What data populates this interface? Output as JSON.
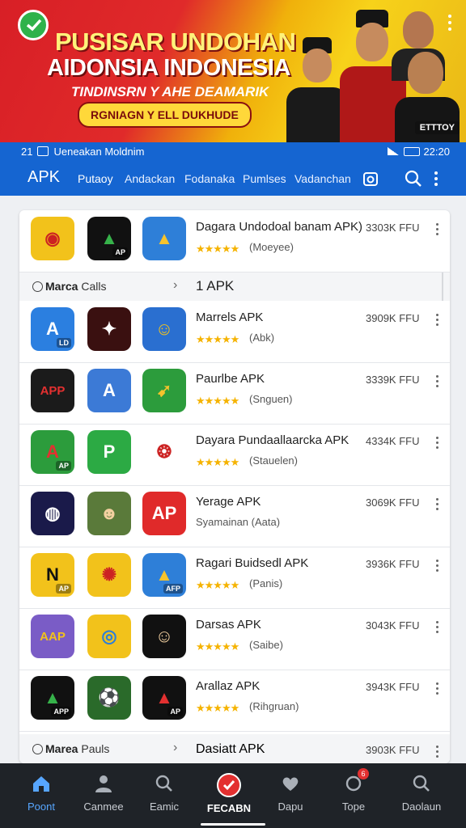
{
  "banner": {
    "title_line1": "PUSISAR UNDOHAN",
    "title_line2": "AIDONSIA INDONESIA",
    "subtitle": "TINDINSRN Y AHE DEAMARIK",
    "pill": "RGNIAGN Y ELL DUKHUDE",
    "brand": "ETTTOY"
  },
  "status_bar": {
    "left": "21",
    "carrier": "Ueneakan Moldnim",
    "time": "22:20"
  },
  "app_bar": {
    "title": "APK",
    "tabs": [
      "Putaoy",
      "Andackan",
      "Fodanaka",
      "Pumlses",
      "Vadanchan"
    ]
  },
  "sections": [
    {
      "label_bold": "Marca",
      "label_rest": " Calls",
      "count": "1 APK"
    },
    {
      "label_bold": "Marea",
      "label_rest": " Pauls"
    }
  ],
  "apps": [
    {
      "name": "Dagara Undodoal banam APK)",
      "stars": "★★★★★",
      "tag": "(Moeyee)",
      "size": "3303K FFU",
      "icons": [
        {
          "name": "emblem-icon",
          "bg": "#f2c21b",
          "fg": "#c22",
          "text": "◉",
          "mini": ""
        },
        {
          "name": "play-logo-icon",
          "bg": "#111111",
          "fg": "#36b24a",
          "text": "▲",
          "mini": "AP"
        },
        {
          "name": "drive-icon",
          "bg": "#2e7fd8",
          "fg": "#f6c32c",
          "text": "▲",
          "mini": ""
        }
      ]
    },
    {
      "name": "Marrels  APK",
      "stars": "★★★★★",
      "tag": "(Abk)",
      "size": "3909K FFU",
      "icons": [
        {
          "name": "a-logo-icon",
          "bg": "#2b7fe0",
          "fg": "#ffffff",
          "text": "A",
          "mini": "LD"
        },
        {
          "name": "tiger-icon",
          "bg": "#3a1010",
          "fg": "#ffffff",
          "text": "✦",
          "mini": ""
        },
        {
          "name": "portrait-icon",
          "bg": "#2a6fd0",
          "fg": "#f2c21b",
          "text": "☺",
          "mini": ""
        }
      ]
    },
    {
      "name": "Paurlbe APK",
      "stars": "★★★★★",
      "tag": "(Snguen)",
      "size": "3339K FFU",
      "icons": [
        {
          "name": "flag-app-icon",
          "bg": "#1b1b1b",
          "fg": "#e33030",
          "text": "APP",
          "mini": ""
        },
        {
          "name": "a-logo-icon",
          "bg": "#3c7ad6",
          "fg": "#ffffff",
          "text": "A",
          "mini": ""
        },
        {
          "name": "rocket-icon",
          "bg": "#2c9c3c",
          "fg": "#f6c32c",
          "text": "➹",
          "mini": ""
        }
      ]
    },
    {
      "name": "Dayara Pundaallaarcka APK",
      "stars": "★★★★★",
      "tag": "(Stauelen)",
      "size": "4334K FFU",
      "icons": [
        {
          "name": "a-red-icon",
          "bg": "#2c9c3c",
          "fg": "#e33030",
          "text": "A",
          "mini": "AP"
        },
        {
          "name": "p-logo-icon",
          "bg": "#2caa44",
          "fg": "#ffffff",
          "text": "P",
          "mini": ""
        },
        {
          "name": "seal-icon",
          "bg": "#ffffff",
          "fg": "#c22",
          "text": "❂",
          "mini": ""
        }
      ]
    },
    {
      "name": "Yerage APK",
      "stars": "",
      "tag": "Syamainan  (Aata)",
      "size": "3069K FFU",
      "icons": [
        {
          "name": "globe-icon",
          "bg": "#1a1a4a",
          "fg": "#ffffff",
          "text": "◍",
          "mini": ""
        },
        {
          "name": "face-icon",
          "bg": "#5a7a3a",
          "fg": "#f2d0a0",
          "text": "☻",
          "mini": ""
        },
        {
          "name": "ap-badge-icon",
          "bg": "#e02a2a",
          "fg": "#ffffff",
          "text": "AP",
          "mini": ""
        }
      ]
    },
    {
      "name": "Ragari Buidsedl APK",
      "stars": "★★★★★",
      "tag": "(Panis)",
      "size": "3936K FFU",
      "icons": [
        {
          "name": "nusa-icon",
          "bg": "#f2c21b",
          "fg": "#111111",
          "text": "N",
          "mini": "AP"
        },
        {
          "name": "garuda-icon",
          "bg": "#f2c21b",
          "fg": "#c22",
          "text": "✺",
          "mini": ""
        },
        {
          "name": "drive-icon",
          "bg": "#2e7fd8",
          "fg": "#f6c32c",
          "text": "▲",
          "mini": "AFP"
        }
      ]
    },
    {
      "name": "Darsas APK",
      "stars": "★★★★★",
      "tag": "(Saibe)",
      "size": "3043K FFU",
      "icons": [
        {
          "name": "aap-icon",
          "bg": "#7a5cc6",
          "fg": "#f2c21b",
          "text": "AAP",
          "mini": ""
        },
        {
          "name": "chrome-icon",
          "bg": "#f2c21b",
          "fg": "#2e7fd8",
          "text": "◎",
          "mini": ""
        },
        {
          "name": "man-portrait-icon",
          "bg": "#111111",
          "fg": "#f2d0a0",
          "text": "☺",
          "mini": ""
        }
      ]
    },
    {
      "name": "Arallaz APK",
      "stars": "★★★★★",
      "tag": "(Rihgruan)",
      "size": "3943K FFU",
      "icons": [
        {
          "name": "play-logo-icon",
          "bg": "#111111",
          "fg": "#36b24a",
          "text": "▲",
          "mini": "APP"
        },
        {
          "name": "soccer-icon",
          "bg": "#2a6a2a",
          "fg": "#ffffff",
          "text": "⚽",
          "mini": ""
        },
        {
          "name": "play-logo-icon",
          "bg": "#111111",
          "fg": "#e33030",
          "text": "▲",
          "mini": "AP"
        }
      ]
    },
    {
      "name": "Dasiatt APK",
      "stars": "",
      "tag": "",
      "size": "3903K FFU",
      "icons": []
    }
  ],
  "bottom_nav": [
    {
      "label": "Poont",
      "icon": "home-icon"
    },
    {
      "label": "Canmee",
      "icon": "person-icon"
    },
    {
      "label": "Eamic",
      "icon": "search-icon"
    },
    {
      "label": "FECABN",
      "icon": "check-circle-icon"
    },
    {
      "label": "Dapu",
      "icon": "heart-icon"
    },
    {
      "label": "Tope",
      "icon": "notification-icon",
      "badge": "6"
    },
    {
      "label": "Daolaun",
      "icon": "search-icon"
    }
  ],
  "colors": {
    "primary": "#1565d1",
    "star": "#f5b300",
    "accent_red": "#e33030",
    "nav_bg": "#1f2328"
  }
}
